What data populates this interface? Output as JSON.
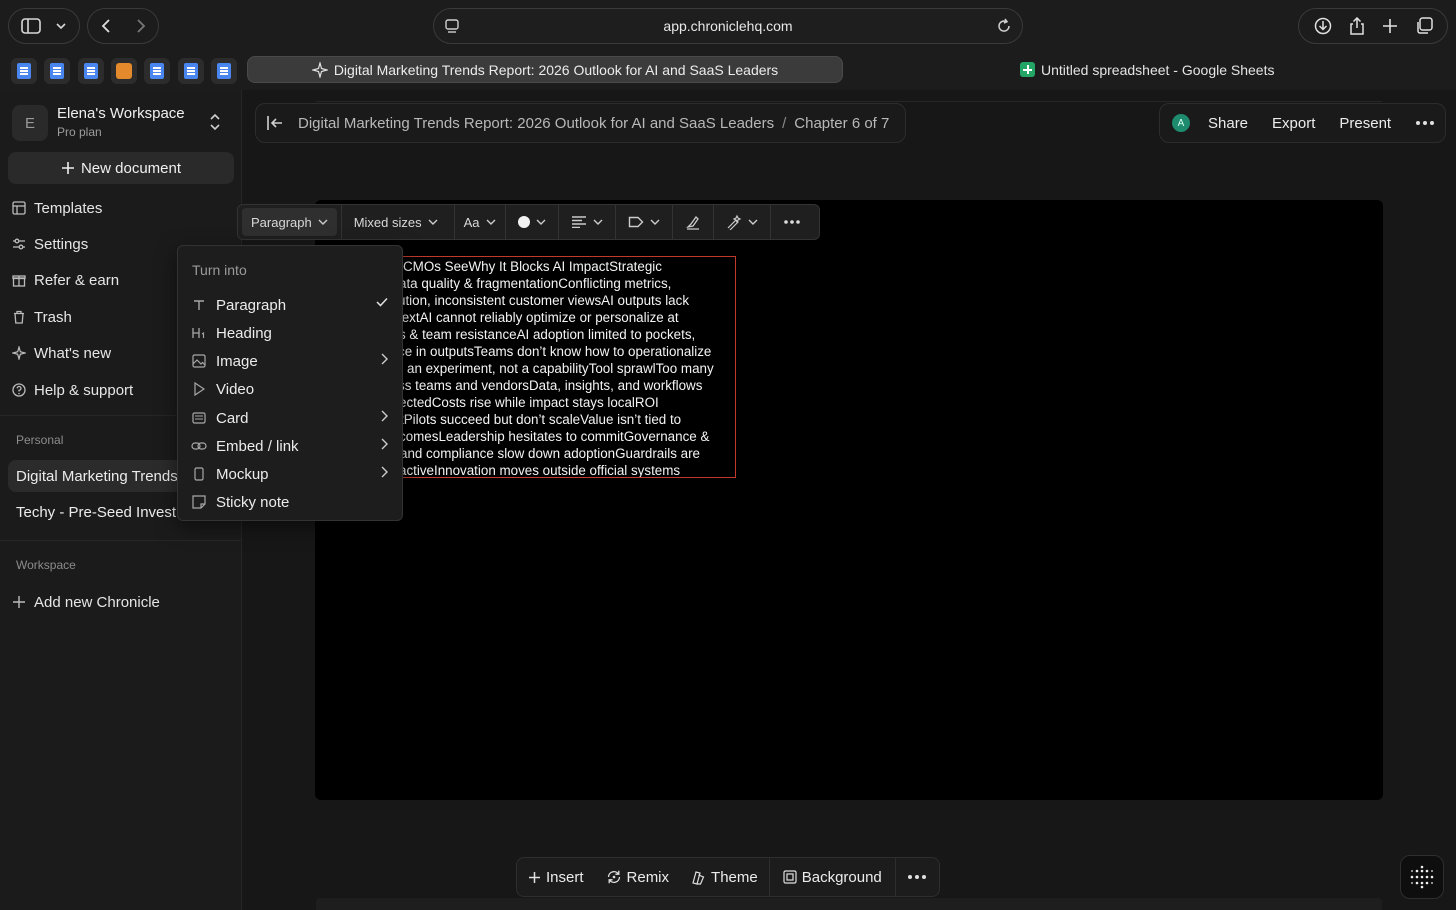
{
  "browser": {
    "url": "app.chroniclehq.com",
    "tabs": [
      {
        "label": "Digital Marketing Trends Report: 2026 Outlook for AI and SaaS Leaders",
        "active": true
      },
      {
        "label": "Untitled spreadsheet - Google Sheets",
        "active": false
      }
    ]
  },
  "sidebar": {
    "workspace_initial": "E",
    "workspace_name": "Elena's Workspace",
    "workspace_plan": "Pro plan",
    "new_document": "New document",
    "nav": [
      {
        "label": "Templates",
        "icon": "templates-icon"
      },
      {
        "label": "Settings",
        "icon": "settings-icon"
      },
      {
        "label": "Refer & earn",
        "icon": "gift-icon"
      },
      {
        "label": "Trash",
        "icon": "trash-icon"
      },
      {
        "label": "What's new",
        "icon": "sparkle-icon"
      },
      {
        "label": "Help & support",
        "icon": "help-icon"
      }
    ],
    "personal_label": "Personal",
    "personal_docs": [
      "Digital Marketing Trends",
      "Techy - Pre-Seed Invest"
    ],
    "workspace_label": "Workspace",
    "add_new": "Add new Chronicle"
  },
  "header": {
    "doc_title": "Digital Marketing Trends Report: 2026 Outlook for AI and SaaS Leaders",
    "separator": "/",
    "chapter": "Chapter 6 of 7",
    "avatar_initial": "A",
    "share": "Share",
    "export": "Export",
    "present": "Present"
  },
  "toolbar": {
    "block_type": "Paragraph",
    "size": "Mixed sizes",
    "font": "Aa"
  },
  "dropdown": {
    "header": "Turn into",
    "items": [
      {
        "label": "Paragraph",
        "icon": "text-icon",
        "checked": true
      },
      {
        "label": "Heading",
        "icon": "heading-icon"
      },
      {
        "label": "Image",
        "icon": "image-icon",
        "submenu": true
      },
      {
        "label": "Video",
        "icon": "play-icon"
      },
      {
        "label": "Card",
        "icon": "card-icon",
        "submenu": true
      },
      {
        "label": "Embed / link",
        "icon": "link-icon",
        "submenu": true
      },
      {
        "label": "Mockup",
        "icon": "phone-icon",
        "submenu": true
      },
      {
        "label": "Sticky note",
        "icon": "sticky-note-icon"
      }
    ]
  },
  "textbox": {
    "lines": [
      "CMOs SeeWhy It Blocks AI ImpactStrategic",
      "ata quality & fragmentationConflicting metrics,",
      "ution, inconsistent customer viewsAI outputs lack",
      "textAI cannot reliably optimize or personalize at",
      "s & team resistanceAI adoption limited to pockets,",
      "ce in outputsTeams don’t know how to operationalize",
      "an experiment, not a capabilityTool sprawlToo many",
      "ss teams and vendorsData, insights, and workflows",
      "ectedCosts rise while impact stays localROI",
      "tPilots succeed but don’t scaleValue isn’t tied to",
      "comesLeadership hesitates to commitGovernance &",
      "and compliance slow down adoptionGuardrails are",
      "activeInnovation moves outside official systems"
    ]
  },
  "bottombar": {
    "insert": "Insert",
    "remix": "Remix",
    "theme": "Theme",
    "background": "Background"
  },
  "colors": {
    "accent_avatar": "#1e8a6e",
    "selection_border": "#c0392b",
    "sheets_green": "#23a566"
  }
}
